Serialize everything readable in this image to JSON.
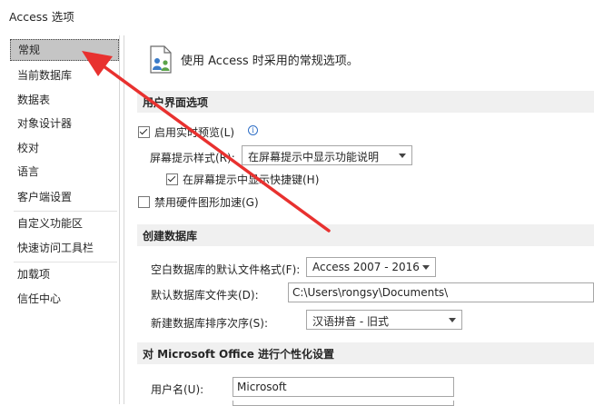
{
  "window": {
    "title": "Access 选项"
  },
  "sidebar": {
    "items": [
      {
        "label": "常规"
      },
      {
        "label": "当前数据库"
      },
      {
        "label": "数据表"
      },
      {
        "label": "对象设计器"
      },
      {
        "label": "校对"
      },
      {
        "label": "语言"
      },
      {
        "label": "客户端设置"
      },
      {
        "label": "自定义功能区"
      },
      {
        "label": "快速访问工具栏"
      },
      {
        "label": "加载项"
      },
      {
        "label": "信任中心"
      }
    ]
  },
  "main": {
    "header_text": "使用 Access 时采用的常规选项。",
    "sections": {
      "ui": {
        "title": "用户界面选项",
        "live_preview_label": "启用实时预览(L)",
        "live_preview_checked": true,
        "tooltip_style_label": "屏幕提示样式(R):",
        "tooltip_style_value": "在屏幕提示中显示功能说明",
        "shortcut_keys_label": "在屏幕提示中显示快捷键(H)",
        "shortcut_keys_checked": true,
        "disable_hw_accel_label": "禁用硬件图形加速(G)",
        "disable_hw_accel_checked": false
      },
      "create_db": {
        "title": "创建数据库",
        "default_format_label": "空白数据库的默认文件格式(F):",
        "default_format_value": "Access 2007 - 2016",
        "default_folder_label": "默认数据库文件夹(D):",
        "default_folder_value": "C:\\Users\\rongsy\\Documents\\",
        "sort_order_label": "新建数据库排序次序(S):",
        "sort_order_value": "汉语拼音 - 旧式"
      },
      "personalize": {
        "title": "对 Microsoft Office 进行个性化设置",
        "username_label": "用户名(U):",
        "username_value": "Microsoft"
      }
    }
  },
  "colors": {
    "annotation_arrow": "#e8312f",
    "section_bg": "#f0f0f0",
    "selected_nav_bg": "#c5c5c5"
  }
}
